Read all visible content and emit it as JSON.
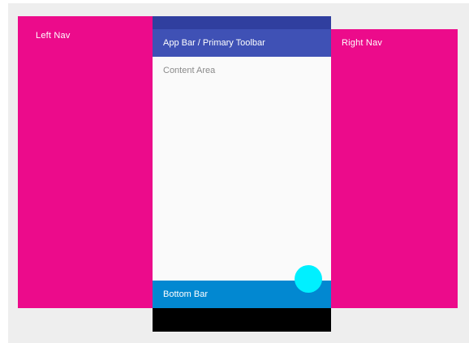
{
  "left_nav": {
    "label": "Left Nav"
  },
  "right_nav": {
    "label": "Right Nav"
  },
  "app_bar": {
    "label": "App Bar / Primary Toolbar"
  },
  "content_area": {
    "label": "Content Area"
  },
  "bottom_bar": {
    "label": "Bottom Bar"
  },
  "colors": {
    "nav_drawer": "#ec0b8b",
    "status_bar": "#303f9f",
    "app_bar": "#3f51b5",
    "content": "#fafafa",
    "bottom_bar": "#0288d1",
    "system_nav_bar": "#000000",
    "fab": "#00f0ff",
    "background": "#eeeeee"
  }
}
